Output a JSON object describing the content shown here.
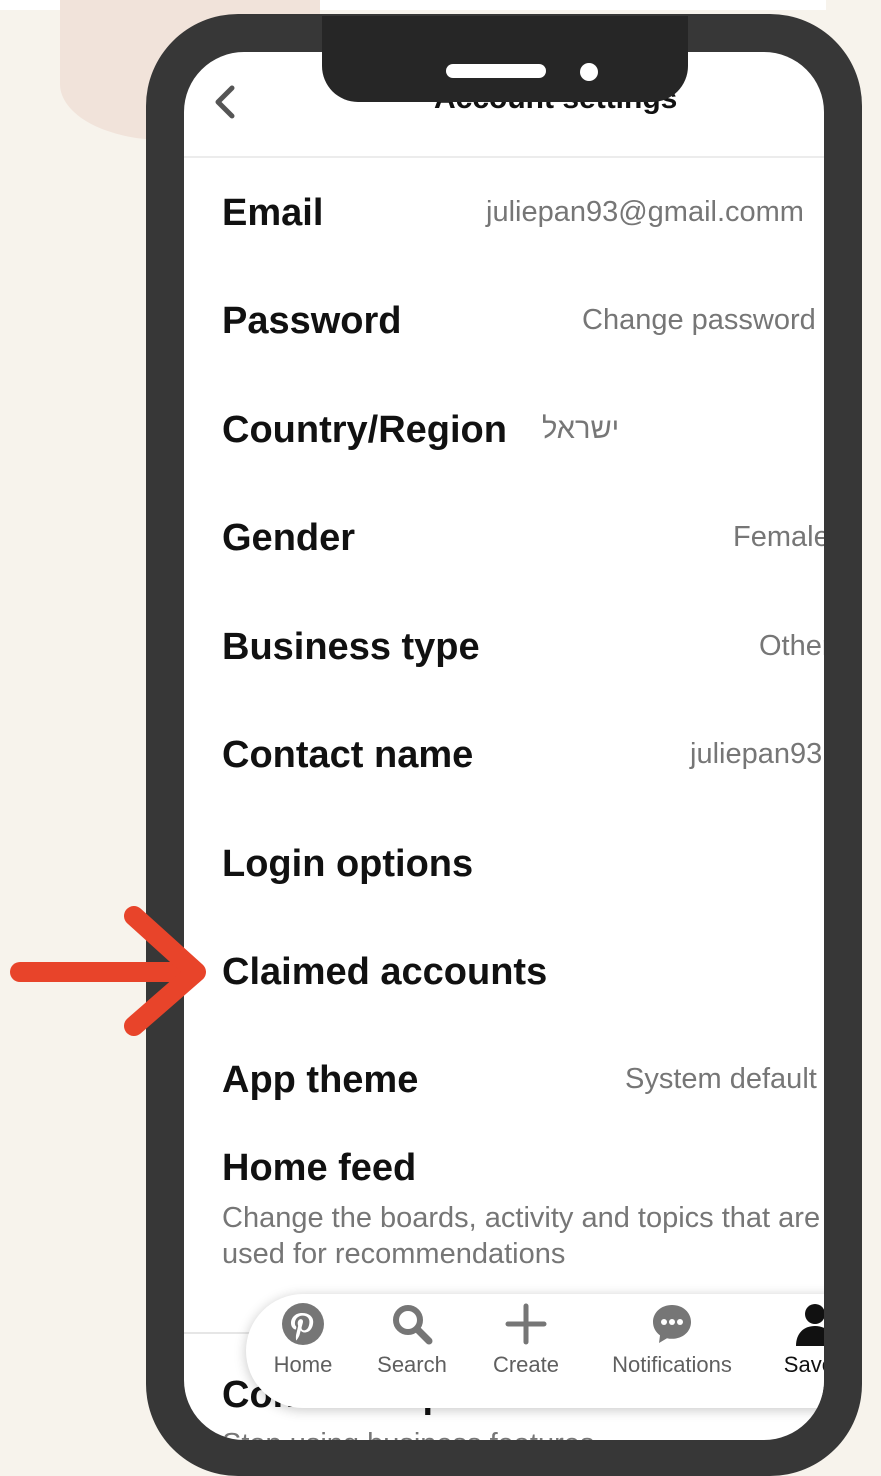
{
  "header": {
    "title": "Account settings"
  },
  "settings": {
    "email": {
      "label": "Email",
      "value": "juliepan93@gmail.comm"
    },
    "password": {
      "label": "Password",
      "value": "Change password"
    },
    "country": {
      "label": "Country/Region",
      "value": "ישראל"
    },
    "gender": {
      "label": "Gender",
      "value": "Female"
    },
    "business_type": {
      "label": "Business type",
      "value": "Other"
    },
    "contact_name": {
      "label": "Contact name",
      "value": "juliepan93"
    },
    "login_options": {
      "label": "Login options"
    },
    "claimed_accounts": {
      "label": "Claimed accounts"
    },
    "app_theme": {
      "label": "App theme",
      "value": "System default"
    },
    "home_feed": {
      "label": "Home feed",
      "description": "Change the boards, activity and topics that are used for recommendations"
    },
    "convert": {
      "label": "Convert to personal account",
      "description": "Stop using business features"
    }
  },
  "navbar": {
    "home": "Home",
    "search": "Search",
    "create": "Create",
    "notifications": "Notifications",
    "saved": "Saved"
  },
  "colors": {
    "accent_arrow": "#e8442a",
    "phone_frame": "#373737",
    "text_primary": "#111111",
    "text_secondary": "#767676"
  },
  "icons": [
    "back-icon",
    "pinterest-home-icon",
    "search-icon",
    "plus-icon",
    "chat-bubble-icon",
    "profile-icon",
    "arrow-annotation"
  ]
}
